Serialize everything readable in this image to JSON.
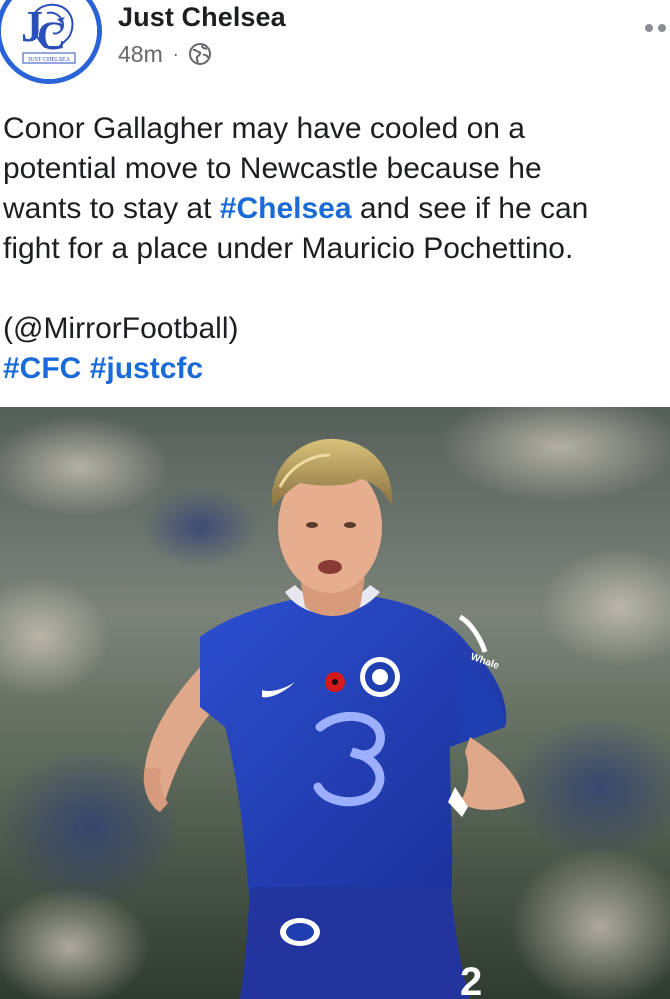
{
  "post": {
    "page_name": "Just Chelsea",
    "time": "48m",
    "separator": "·",
    "privacy_icon": "globe-icon",
    "more_icon": "more-options-icon",
    "avatar": {
      "logo_letters": "JC",
      "logo_caption": "JUST CHELSEA"
    },
    "text": {
      "line1": "Conor Gallagher may have cooled on a",
      "line2": "potential move to Newcastle because he",
      "line3_before": "wants to stay at ",
      "line3_tag": "#Chelsea",
      "line3_after": " and see if he can",
      "line4": "fight for a place under Mauricio Pochettino.",
      "source": "(@MirrorFootball)",
      "hashtag1": "#CFC",
      "hashtag2": "#justcfc"
    },
    "photo": {
      "subject": "footballer-in-blue-kit",
      "sponsor_text": "Whale"
    }
  },
  "colors": {
    "accent": "#1a6bd8",
    "avatar_ring": "#2a63d6",
    "text": "#1c1e21",
    "muted": "#65676b",
    "kit_blue": "#1f3fb0"
  }
}
